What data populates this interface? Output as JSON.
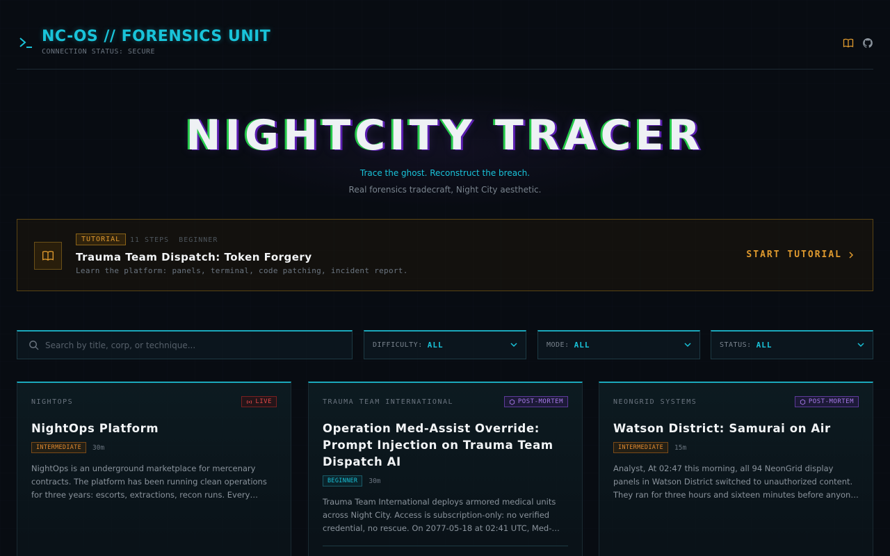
{
  "header": {
    "title": "NC-OS // FORENSICS UNIT",
    "status": "CONNECTION STATUS: SECURE",
    "icons": [
      "book-icon",
      "github-icon"
    ]
  },
  "hero": {
    "title": "NIGHTCITY TRACER",
    "tagline": "Trace the ghost. Reconstruct the breach.",
    "subtitle": "Real forensics tradecraft, Night City aesthetic."
  },
  "tutorial": {
    "badge": "TUTORIAL",
    "steps": "11 STEPS",
    "level": "BEGINNER",
    "title": "Trauma Team Dispatch: Token Forgery",
    "description": "Learn the platform: panels, terminal, code patching, incident report.",
    "cta": "START TUTORIAL"
  },
  "filters": {
    "search_placeholder": "Search by title, corp, or technique...",
    "difficulty_label": "DIFFICULTY:",
    "difficulty_value": "ALL",
    "mode_label": "MODE:",
    "mode_value": "ALL",
    "status_label": "STATUS:",
    "status_value": "ALL"
  },
  "cards": [
    {
      "org": "NIGHTOPS",
      "badge": "LIVE",
      "title": "NightOps Platform",
      "difficulty": "INTERMEDIATE",
      "duration": "30m",
      "description": "NightOps is an underground marketplace for mercenary contracts. The platform has been running clean operations for three years: escorts, extractions, recon runs. Every active contract is now compromised."
    },
    {
      "org": "TRAUMA TEAM INTERNATIONAL",
      "badge": "POST-MORTEM",
      "title": "Operation Med-Assist Override: Prompt Injection on Trauma Team Dispatch AI",
      "difficulty": "BEGINNER",
      "duration": "30m",
      "description": "Trauma Team International deploys armored medical units across Night City. Access is subscription-only: no verified credential, no rescue. On 2077-05-18 at 02:41 UTC, Med-Assist-AI began rerouting units."
    },
    {
      "org": "NEONGRID SYSTEMS",
      "badge": "POST-MORTEM",
      "title": "Watson District: Samurai on Air",
      "difficulty": "INTERMEDIATE",
      "duration": "15m",
      "description": "Analyst, At 02:47 this morning, all 94 NeonGrid display panels in Watson District switched to unauthorized content. They ran for three hours and sixteen minutes before anyone noticed. The first reports came from the street."
    }
  ],
  "colors": {
    "accent": "#19c3d9",
    "warning": "#e09a2e",
    "live": "#e04848",
    "postmortem": "#a67ae8",
    "background": "#080c12"
  }
}
